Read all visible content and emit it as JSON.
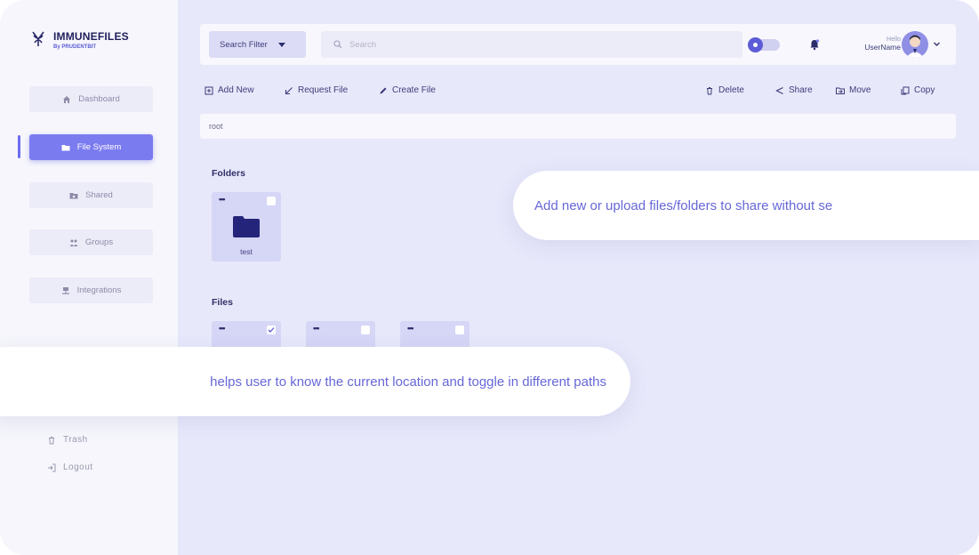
{
  "app": {
    "name": "IMMUNEFILES",
    "tagline": "By PRUDENTBIT"
  },
  "sidebar": {
    "items": [
      {
        "label": "Dashboard",
        "icon": "home-icon",
        "active": false
      },
      {
        "label": "File System",
        "icon": "folder-icon",
        "active": true
      },
      {
        "label": "Shared",
        "icon": "shared-icon",
        "active": false
      },
      {
        "label": "Groups",
        "icon": "groups-icon",
        "active": false
      },
      {
        "label": "Integrations",
        "icon": "integrations-icon",
        "active": false
      }
    ],
    "bottom": [
      {
        "label": "Trash",
        "icon": "trash-icon"
      },
      {
        "label": "Logout",
        "icon": "logout-icon"
      }
    ]
  },
  "topbar": {
    "filter_label": "Search Filter",
    "search_placeholder": "Search",
    "greeting": "Hello",
    "username": "UserName"
  },
  "actions": {
    "add_new": "Add New",
    "request_file": "Request File",
    "create_file": "Create File",
    "delete": "Delete",
    "share": "Share",
    "move": "Move",
    "copy": "Copy"
  },
  "breadcrumb": {
    "path": "root"
  },
  "folders": {
    "title": "Folders",
    "items": [
      {
        "name": "test",
        "checked": false
      }
    ]
  },
  "files": {
    "title": "Files",
    "items": [
      {
        "checked": true
      },
      {
        "checked": false
      },
      {
        "checked": false
      }
    ]
  },
  "tooltips": {
    "upload_hint": "Add new or upload files/folders to share without se",
    "breadcrumb_hint": "helps user to know the current location and toggle in different paths"
  },
  "colors": {
    "accent": "#7b7bf0",
    "sidebar_bg": "#f6f6fc",
    "main_bg": "#e8e8fb",
    "card_bg": "#d6d6f6",
    "text_dark": "#3d3d7a",
    "bubble_text": "#6767d9"
  }
}
